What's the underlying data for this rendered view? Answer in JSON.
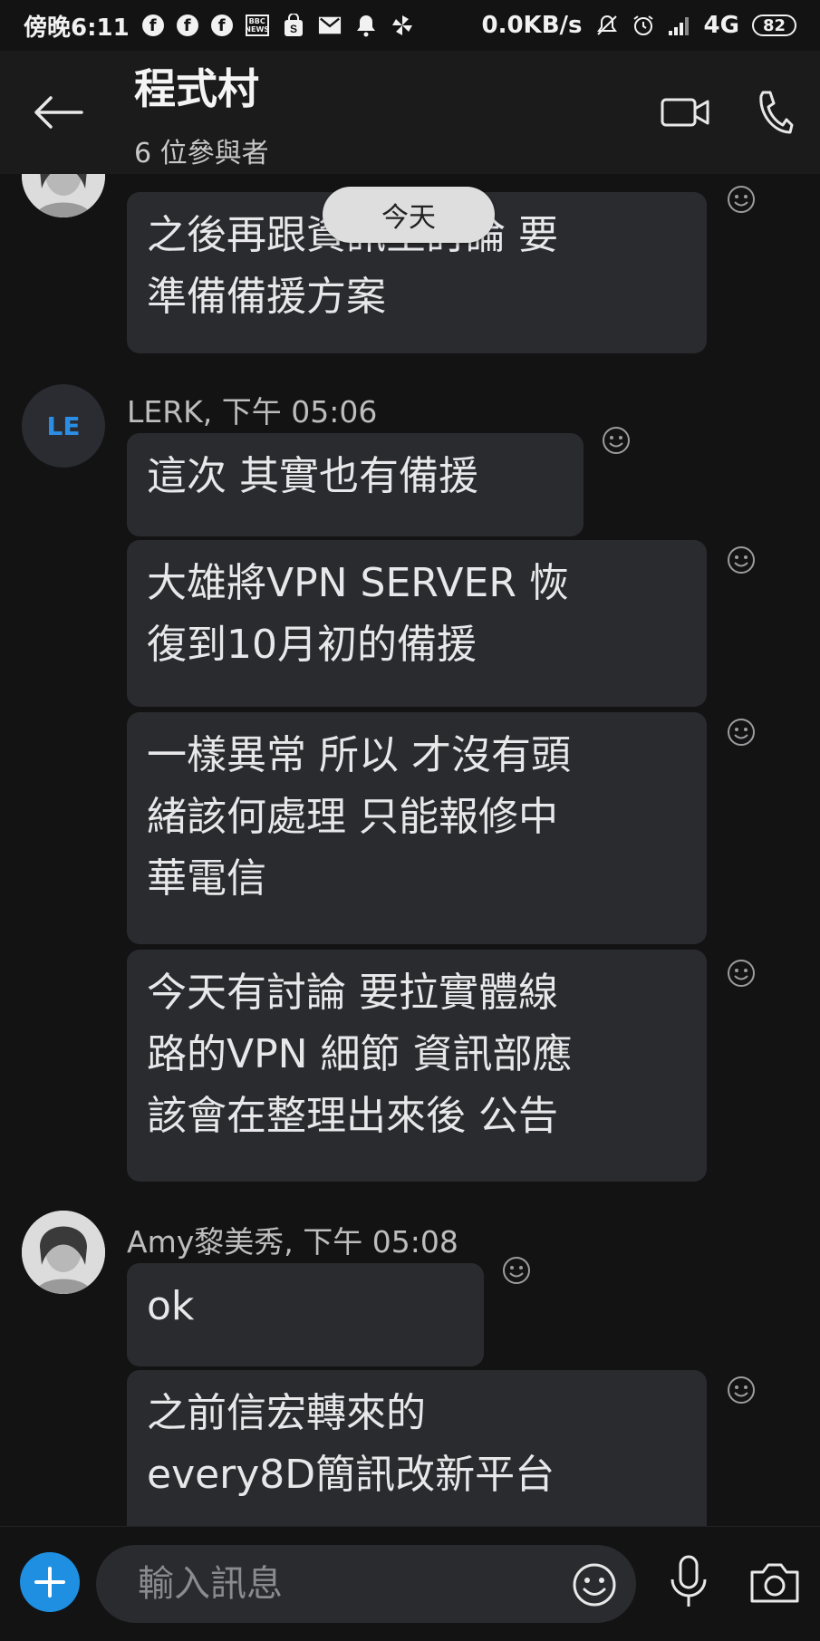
{
  "status_bar": {
    "time": "傍晚6:11",
    "network_speed": "0.0KB/s",
    "network_type": "4G",
    "battery": "82",
    "icons": [
      "facebook-icon",
      "facebook-icon",
      "facebook-icon",
      "bbc-news-icon",
      "shopee-icon",
      "gmail-icon",
      "bell-icon",
      "pinwheel-icon",
      "mute-icon",
      "alarm-icon",
      "signal-icon"
    ]
  },
  "header": {
    "title": "程式村",
    "participants": "6 位參與者"
  },
  "chat": {
    "date_pill": "今天",
    "messages": [
      {
        "sender": "",
        "time": "",
        "text": "之後再跟資訊室討論 要\n準備備援方案"
      },
      {
        "sender": "LERK, 下午 05:06",
        "avatar": "LE",
        "text": "這次 其實也有備援"
      },
      {
        "text": "大雄將VPN SERVER 恢\n復到10月初的備援"
      },
      {
        "text": "一樣異常 所以 才沒有頭\n緒該何處理 只能報修中\n華電信"
      },
      {
        "text": "今天有討論  要拉實體線\n路的VPN  細節 資訊部應\n該會在整理出來後 公告"
      },
      {
        "sender": "Amy黎美秀, 下午 05:08",
        "text": "ok"
      },
      {
        "text": "之前信宏轉來的\nevery8D簡訊改新平台"
      }
    ]
  },
  "composer": {
    "placeholder": "輸入訊息"
  },
  "colors": {
    "background": "#131314",
    "bubble": "#2a2b2e",
    "accent": "#1e8fe1"
  }
}
